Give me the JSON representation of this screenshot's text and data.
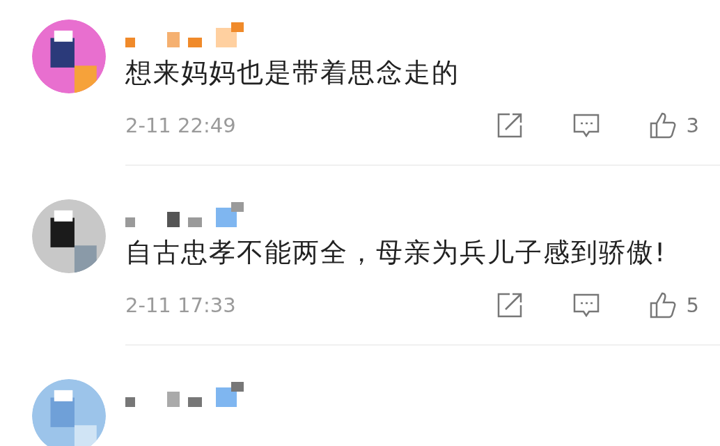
{
  "comments": [
    {
      "kind": "full",
      "text": "想来妈妈也是带着思念走的",
      "time": "2-11 22:49",
      "likes": "3"
    },
    {
      "kind": "full",
      "text": "自古忠孝不能两全，母亲为兵儿子感到骄傲!",
      "time": "2-11 17:33",
      "likes": "5"
    },
    {
      "kind": "cut"
    }
  ]
}
